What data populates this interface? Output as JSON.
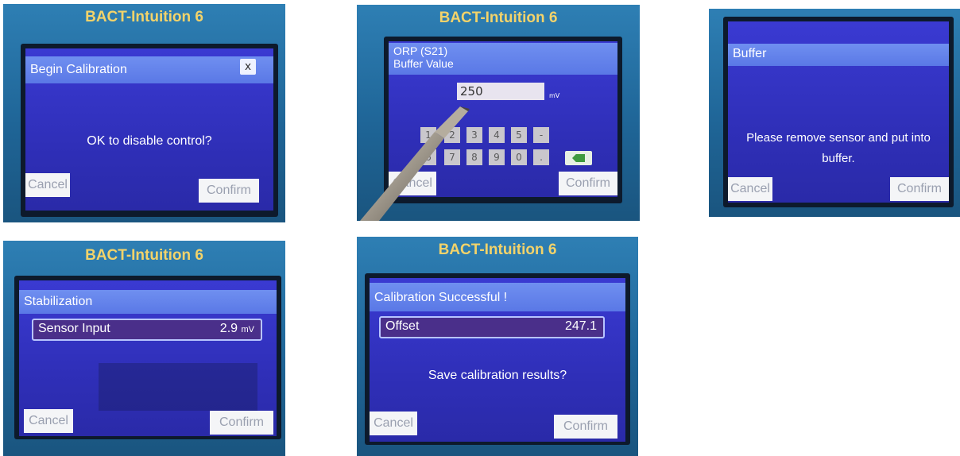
{
  "brand": "BACT-Intuition 6",
  "panel1": {
    "title": "Begin Calibration",
    "close_label": "x",
    "message": "OK to disable control?",
    "cancel": "Cancel",
    "confirm": "Confirm"
  },
  "panel2": {
    "title_line1": "ORP (S21)",
    "title_line2": "Buffer Value",
    "input_value": "250",
    "unit": "mV",
    "keys_row1": [
      "1",
      "2",
      "3",
      "4",
      "5",
      "-"
    ],
    "keys_row2": [
      "6",
      "7",
      "8",
      "9",
      "0",
      "."
    ],
    "cancel": "Cancel",
    "confirm": "Confirm"
  },
  "panel3": {
    "title": "Buffer",
    "message_line1": "Please remove sensor and put into",
    "message_line2": "buffer.",
    "cancel": "Cancel",
    "confirm": "Confirm"
  },
  "panel4": {
    "title": "Stabilization",
    "field_label": "Sensor Input",
    "field_value": "2.9",
    "field_unit": "mV",
    "cancel": "Cancel",
    "confirm": "Confirm"
  },
  "panel5": {
    "title": "Calibration Successful !",
    "field_label": "Offset",
    "field_value": "247.1",
    "message": "Save calibration results?",
    "cancel": "Cancel",
    "confirm": "Confirm"
  }
}
